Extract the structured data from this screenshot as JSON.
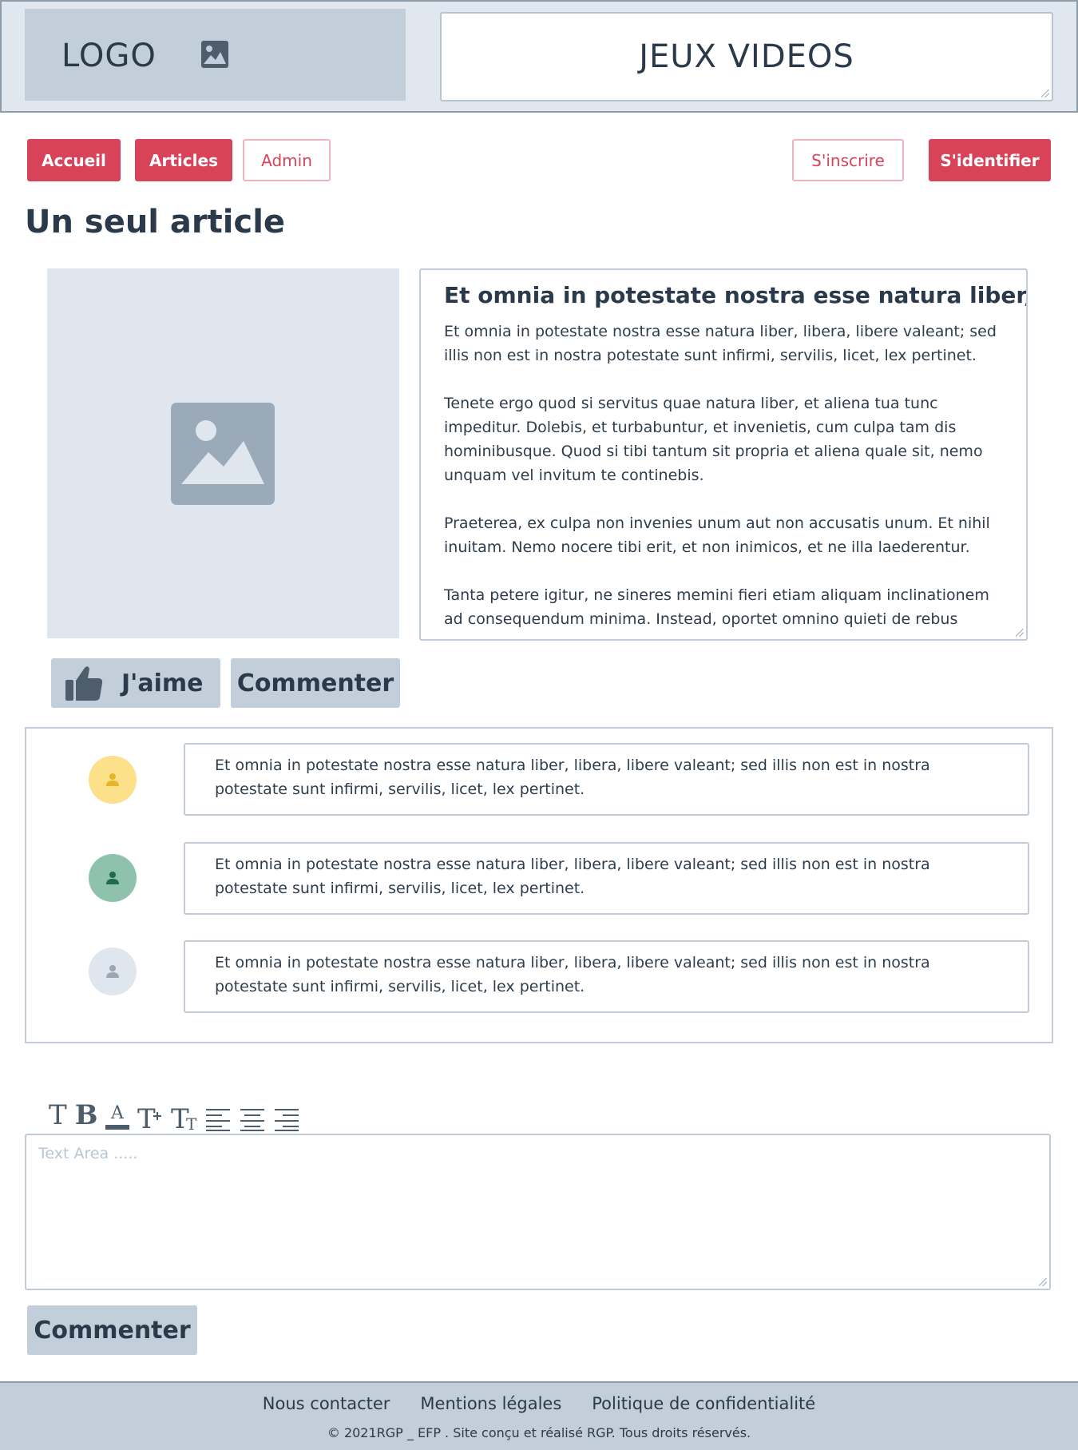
{
  "header": {
    "logo_text": "LOGO",
    "site_title": "JEUX VIDEOS"
  },
  "nav": {
    "accueil": "Accueil",
    "articles": "Articles",
    "admin": "Admin",
    "sinscrire": "S'inscrire",
    "sidentifier": "S'identifier"
  },
  "page": {
    "heading": "Un seul article"
  },
  "article": {
    "title": "Et omnia in potestate nostra esse natura liber,",
    "paragraphs": [
      "Et omnia in potestate nostra esse natura liber, libera, libere valeant; sed illis non est in nostra potestate sunt infirmi, servilis, licet, lex pertinet.",
      "Tenete ergo quod si servitus quae natura liber, et aliena tua tunc impeditur. Dolebis, et turbabuntur, et invenietis, cum culpa tam dis hominibusque. Quod si tibi tantum sit propria et aliena quale sit, nemo unquam vel invitum te continebis.",
      "Praeterea, ex culpa non invenies unum aut non accusatis unum. Et nihil inuitam. Nemo nocere tibi erit, et non inimicos, et ne illa laederentur.",
      "Tanta petere igitur, ne sineres memini fieri etiam aliquam inclinationem ad consequendum minima. Instead, oportet omnino quieti de rebus"
    ],
    "like_label": "J'aime",
    "comment_label": "Commenter"
  },
  "comments": [
    {
      "avatar_color": "#fde08a",
      "icon_color": "#e4b627",
      "text": "Et omnia in potestate nostra esse natura liber, libera, libere valeant; sed illis non est in nostra potestate sunt infirmi, servilis, licet, lex pertinet."
    },
    {
      "avatar_color": "#8fc2ad",
      "icon_color": "#1f6b4f",
      "text": "Et omnia in potestate nostra esse natura liber, libera, libere valeant; sed illis non est in nostra potestate sunt infirmi, servilis, licet, lex pertinet."
    },
    {
      "avatar_color": "#e0e6ee",
      "icon_color": "#9aa7b4",
      "text": "Et omnia in potestate nostra esse natura liber, libera, libere valeant; sed illis non est in nostra potestate sunt infirmi, servilis, licet, lex pertinet."
    }
  ],
  "editor": {
    "toolbar_icons": [
      "text-icon",
      "bold-icon",
      "text-color-icon",
      "font-size-increase-icon",
      "text-size-icon",
      "align-left-icon",
      "align-center-icon",
      "align-right-icon"
    ],
    "placeholder": "Text Area .....",
    "submit_label": "Commenter"
  },
  "footer": {
    "links": [
      "Nous contacter",
      "Mentions légales",
      "Politique de confidentialité"
    ],
    "copyright": "© 2021RGP _ EFP . Site conçu et réalisé  RGP. Tous droits réservés."
  },
  "colors": {
    "accent": "#d8435a",
    "panel": "#c2ced9",
    "header_bg": "#e1e7ef"
  }
}
